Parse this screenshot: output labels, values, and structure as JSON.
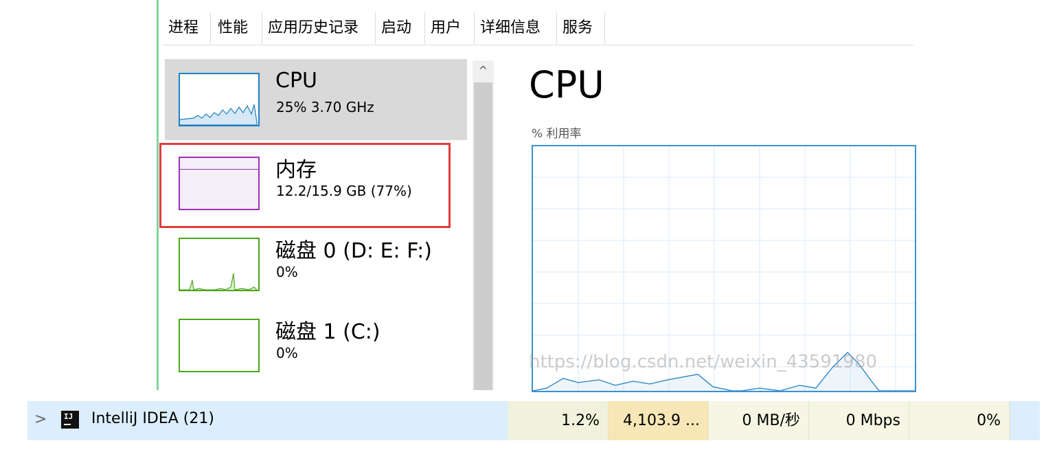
{
  "tabs": [
    "进程",
    "性能",
    "应用历史记录",
    "启动",
    "用户",
    "详细信息",
    "服务"
  ],
  "active_tab": "性能",
  "sidebar": {
    "items": [
      {
        "title": "CPU",
        "sub": "25%  3.70 GHz",
        "color": "#1d7fc4"
      },
      {
        "title": "内存",
        "sub": "12.2/15.9 GB (77%)",
        "color": "#9b30b8"
      },
      {
        "title": "磁盘 0 (D: E: F:)",
        "sub": "0%",
        "color": "#4aa61a"
      },
      {
        "title": "磁盘 1 (C:)",
        "sub": "0%",
        "color": "#4aa61a"
      }
    ],
    "scroll_up_glyph": "^"
  },
  "main": {
    "title": "CPU",
    "util_label": "% 利用率",
    "watermark": "https://blog.csdn.net/weixin_43591980"
  },
  "process_row": {
    "chevron": ">",
    "icon_text": "IJ",
    "name": "IntelliJ IDEA (21)",
    "cpu": "1.2%",
    "memory": "4,103.9 ...",
    "disk": "0 MB/秒",
    "network": "0 Mbps",
    "gpu": "0%"
  }
}
